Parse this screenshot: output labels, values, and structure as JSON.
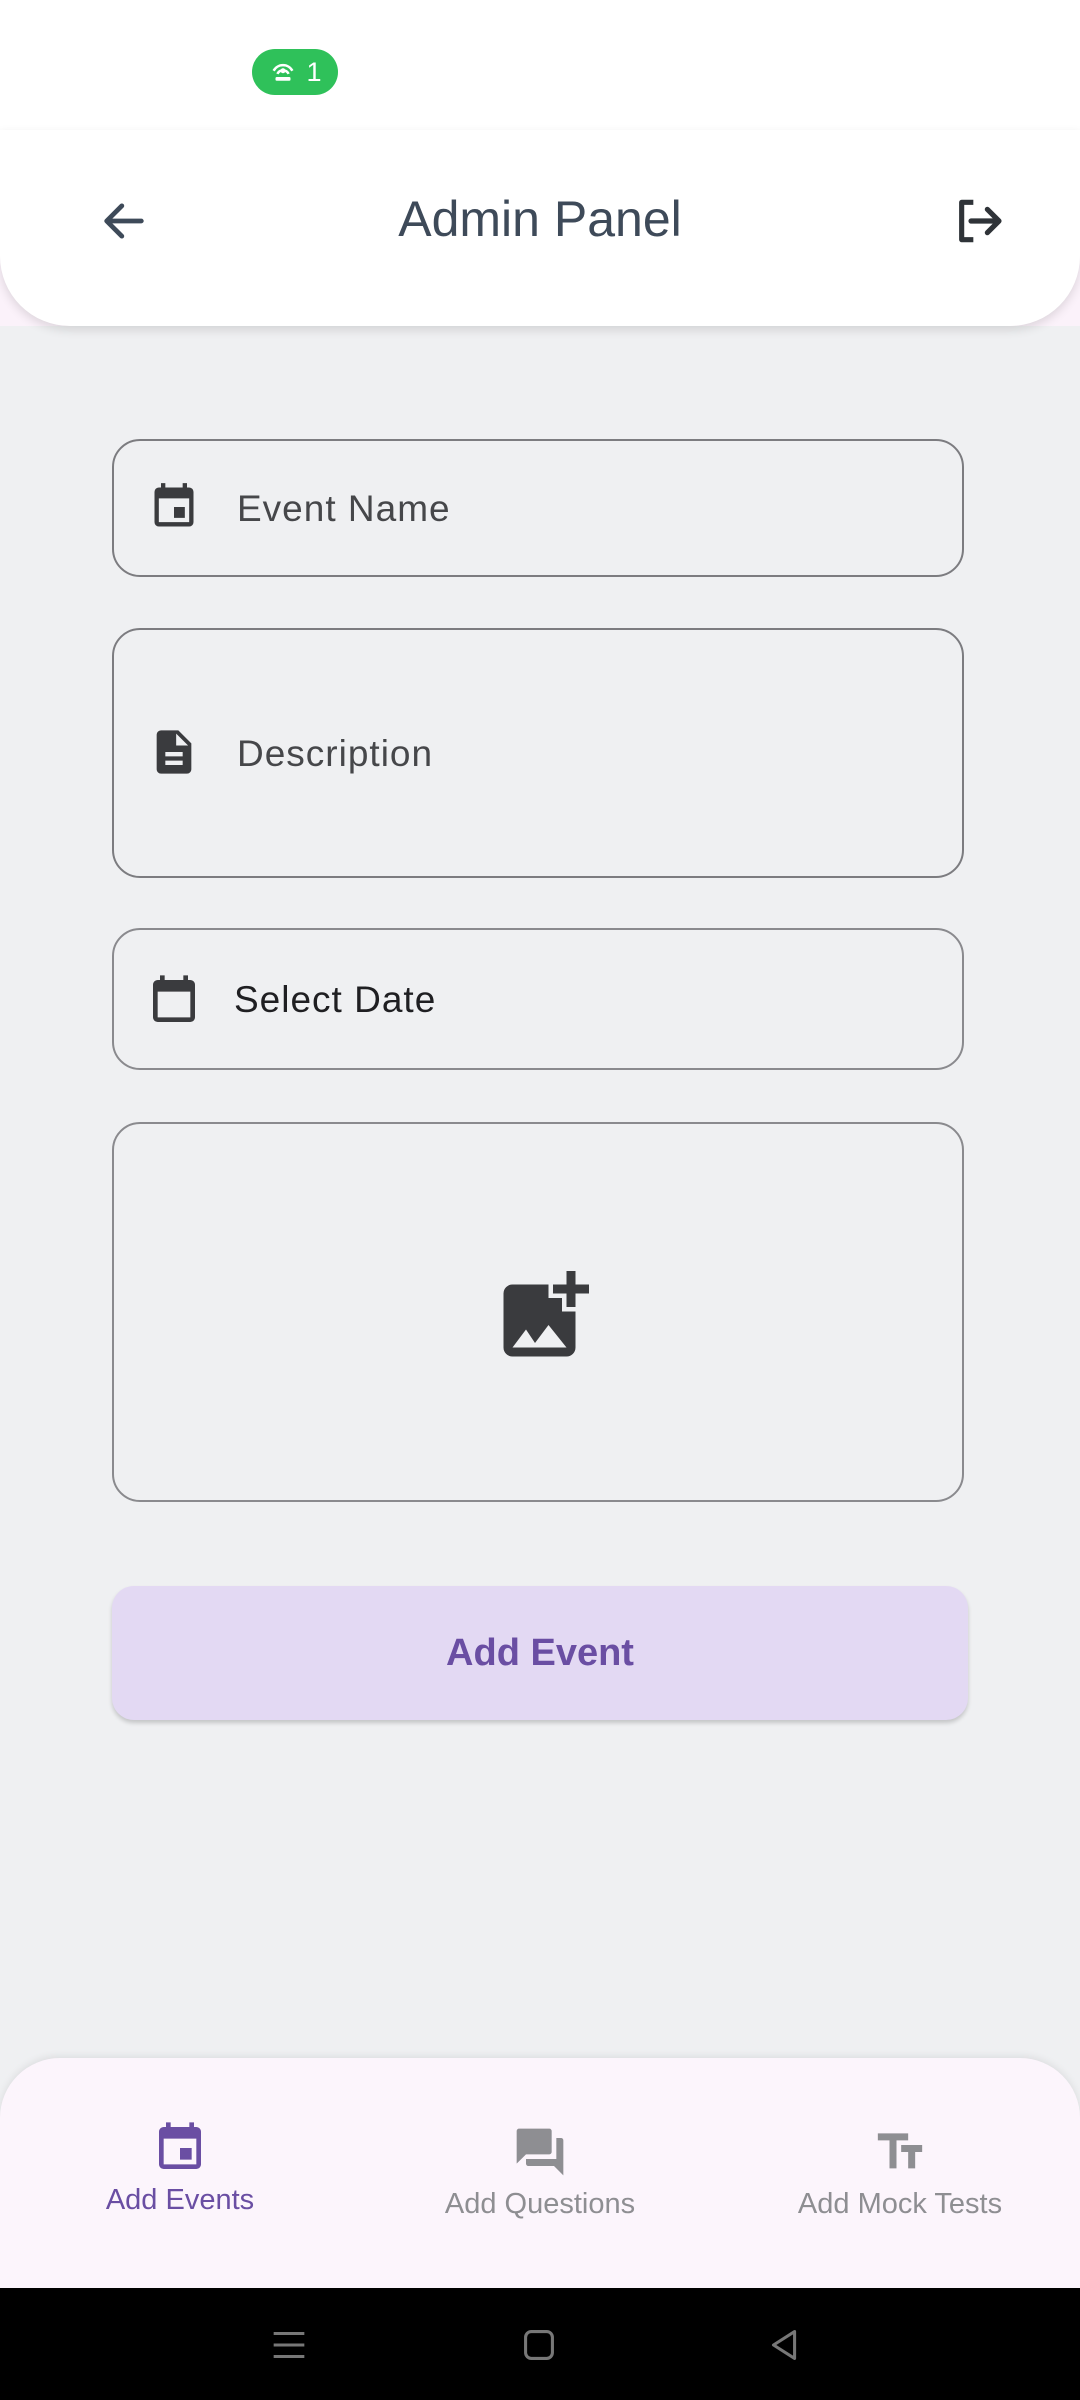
{
  "status_bar": {
    "hotspot_count": "1",
    "pill_color": "#2fc15a"
  },
  "header": {
    "title": "Admin Panel",
    "back_icon": "arrow-left-icon",
    "logout_icon": "logout-icon"
  },
  "form": {
    "event_name_label": "Event Name",
    "description_label": "Description",
    "date_label": "Select Date",
    "image_icon": "add-photo-icon",
    "submit_label": "Add Event"
  },
  "bottom_nav": {
    "items": [
      {
        "label": "Add Events",
        "icon": "event-icon",
        "active": true
      },
      {
        "label": "Add Questions",
        "icon": "forum-icon",
        "active": false
      },
      {
        "label": "Add Mock Tests",
        "icon": "text-fields-icon",
        "active": false
      }
    ]
  },
  "colors": {
    "accent": "#6a4ea3",
    "inactive": "#8e8e92",
    "button_bg": "#e3d9f3",
    "page_bg": "#eff0f2"
  }
}
